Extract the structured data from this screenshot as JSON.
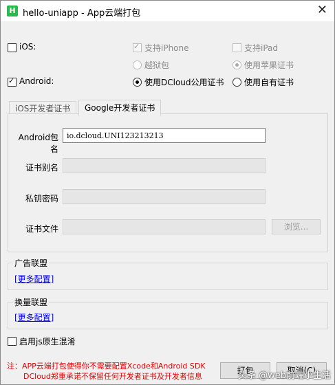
{
  "window": {
    "title": "hello-uniapp - App云端打包",
    "icon_text": "H",
    "close_glyph": "✕"
  },
  "platforms": {
    "ios": {
      "label": "iOS:",
      "checked": false
    },
    "iphone": {
      "label": "支持iPhone",
      "checked": true,
      "disabled": true
    },
    "ipad": {
      "label": "支持iPad",
      "checked": false,
      "disabled": true
    },
    "jailbreak": {
      "label": "越狱包",
      "selected": false,
      "disabled": true
    },
    "apple_cert": {
      "label": "使用苹果证书",
      "selected": true,
      "disabled": true
    },
    "android": {
      "label": "Android:",
      "checked": true
    },
    "dcloud_cert": {
      "label": "使用DCloud公用证书",
      "selected": true
    },
    "own_cert": {
      "label": "使用自有证书",
      "selected": false
    }
  },
  "tabs": [
    {
      "label": "iOS开发者证书",
      "active": false
    },
    {
      "label": "Google开发者证书",
      "active": true
    }
  ],
  "form": {
    "package_label": "Android包名",
    "package_value": "io.dcloud.UNI123213213",
    "alias_label": "证书别名",
    "alias_value": "",
    "key_password_label": "私钥密码",
    "key_password_value": "",
    "cert_file_label": "证书文件",
    "cert_file_value": "",
    "browse_label": "浏览..."
  },
  "ad_group": {
    "title": "广告联盟",
    "link": "[更多配置]"
  },
  "exchange_group": {
    "title": "换量联盟",
    "link": "[更多配置]"
  },
  "obfuscate": {
    "label": "启用js原生混淆",
    "checked": false
  },
  "notice": {
    "line1": "注：APP云端打包使得你不需要配置Xcode和Android SDK",
    "line2": "DCloud郑重承诺不保留任何开发者证书及开发者信息"
  },
  "buttons": {
    "pack": "打包",
    "cancel": "取消(C)"
  },
  "watermark": "头条 @web前端小生活"
}
